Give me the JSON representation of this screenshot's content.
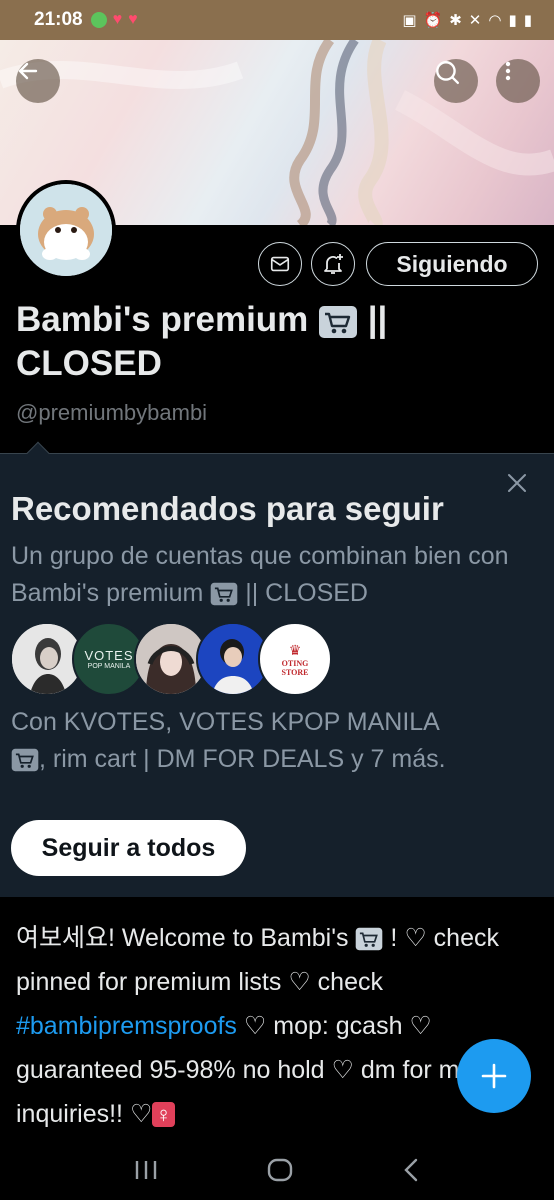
{
  "status_bar": {
    "time": "21:08",
    "left_icons": [
      "app-icon",
      "heart-icon",
      "heart-icon"
    ],
    "right_icons": [
      "battery-saver-icon",
      "alarm-icon",
      "bluetooth-icon",
      "mute-icon",
      "wifi-icon",
      "signal-icon",
      "battery-icon"
    ]
  },
  "header": {
    "back_icon": "arrow-left-icon",
    "search_icon": "search-icon",
    "more_icon": "more-vertical-icon"
  },
  "profile": {
    "message_icon": "mail-icon",
    "notify_icon": "bell-plus-icon",
    "follow_label": "Siguiendo",
    "name_line1": "Bambi's premium",
    "name_suffix1": "||",
    "name_line2": "CLOSED",
    "handle": "@premiumbybambi"
  },
  "recommendations": {
    "title": "Recomendados para seguir",
    "subtitle_a": "Un grupo de cuentas que combinan bien con Bambi's premium",
    "subtitle_b": "|| CLOSED",
    "avatar_texts": {
      "votes": "VOTES",
      "votes_sub": "POP MANILA",
      "store": "OTING\nSTORE"
    },
    "with_a": "Con KVOTES, VOTES KPOP MANILA",
    "with_b": ", rim cart | DM FOR DEALS y 7 más.",
    "follow_all_label": "Seguir a todos"
  },
  "bio": {
    "p1": "여보세요! Welcome to Bambi's",
    "p2": "! ♡ check pinned for premium lists  ♡ check",
    "hashtag": "#bambipremsproofs",
    "p3": " ♡ mop: gcash ♡ guaranteed 95-98% no hold ♡ dm for more inquiries!! ♡",
    "emoji": "♀"
  },
  "colors": {
    "accent": "#1d9bf0",
    "panel": "#15202b",
    "muted": "#8b98a5"
  }
}
